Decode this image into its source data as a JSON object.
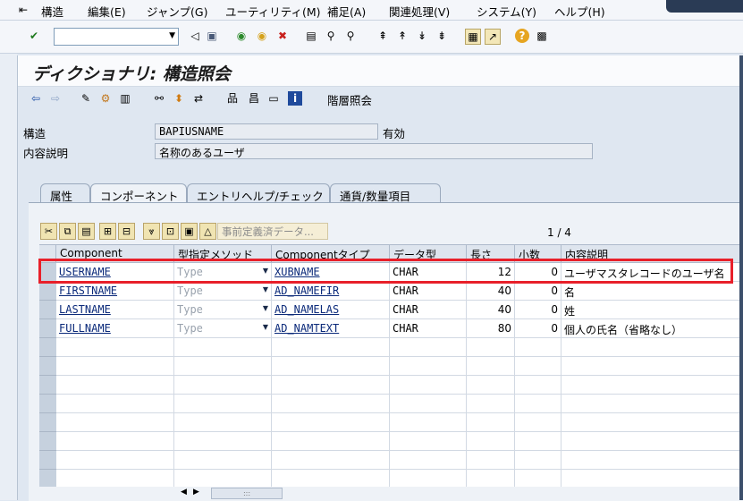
{
  "menu": {
    "items": [
      {
        "label": "構造"
      },
      {
        "label": "編集(E)"
      },
      {
        "label": "ジャンプ(G)"
      },
      {
        "label": "ユーティリティ(M)"
      },
      {
        "label": "補足(A)"
      },
      {
        "label": "関連処理(V)"
      },
      {
        "label": "システム(Y)"
      },
      {
        "label": "ヘルプ(H)"
      }
    ]
  },
  "command": {
    "value": ""
  },
  "title": "ディクショナリ: 構造照会",
  "app_toolbar": {
    "hierarchy_label": "階層照会"
  },
  "fields": {
    "structure_label": "構造",
    "structure_value": "BAPIUSNAME",
    "structure_status": "有効",
    "desc_label": "内容説明",
    "desc_value": "名称のあるユーザ"
  },
  "tabs": [
    {
      "label": "属性"
    },
    {
      "label": "コンポーネント"
    },
    {
      "label": "エントリヘルプ/チェック"
    },
    {
      "label": "通貨/数量項目"
    }
  ],
  "grid_toolbar": {
    "predefined_label": "事前定義済データ..."
  },
  "page_info": "1 / 4",
  "table": {
    "columns": [
      "Component",
      "型指定メソッド",
      "Componentタイプ",
      "データ型",
      "長さ",
      "小数",
      "内容説明"
    ],
    "rows": [
      {
        "component": "USERNAME",
        "method": "Type",
        "ctype": "XUBNAME",
        "dtype": "CHAR",
        "length": "12",
        "decimals": "0",
        "desc": "ユーザマスタレコードのユーザ名"
      },
      {
        "component": "FIRSTNAME",
        "method": "Type",
        "ctype": "AD_NAMEFIR",
        "dtype": "CHAR",
        "length": "40",
        "decimals": "0",
        "desc": "名"
      },
      {
        "component": "LASTNAME",
        "method": "Type",
        "ctype": "AD_NAMELAS",
        "dtype": "CHAR",
        "length": "40",
        "decimals": "0",
        "desc": "姓"
      },
      {
        "component": "FULLNAME",
        "method": "Type",
        "ctype": "AD_NAMTEXT",
        "dtype": "CHAR",
        "length": "80",
        "decimals": "0",
        "desc": "個人の氏名（省略なし）"
      }
    ]
  },
  "colors": {
    "highlight": "#e8202a",
    "link": "#0b2a7a",
    "grid_header": "#dee5ee"
  }
}
